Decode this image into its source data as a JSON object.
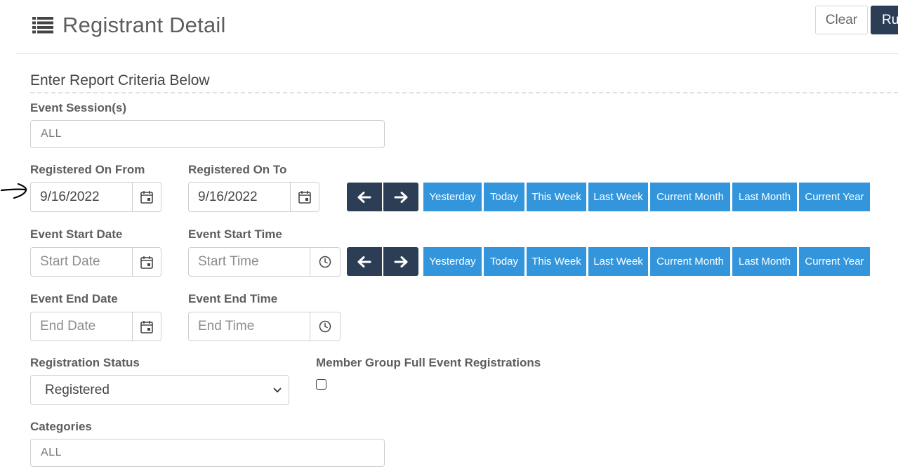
{
  "header": {
    "title": "Registrant Detail",
    "clear_label": "Clear",
    "run_label": "Ru"
  },
  "section_title": "Enter Report Criteria Below",
  "event_sessions": {
    "label": "Event Session(s)",
    "value": "ALL"
  },
  "registered_from": {
    "label": "Registered On From",
    "value": "9/16/2022"
  },
  "registered_to": {
    "label": "Registered On To",
    "value": "9/16/2022"
  },
  "event_start_date": {
    "label": "Event Start Date",
    "placeholder": "Start Date"
  },
  "event_start_time": {
    "label": "Event Start Time",
    "placeholder": "Start Time"
  },
  "event_end_date": {
    "label": "Event End Date",
    "placeholder": "End Date"
  },
  "event_end_time": {
    "label": "Event End Time",
    "placeholder": "End Time"
  },
  "quick_ranges": [
    "Yesterday",
    "Today",
    "This Week",
    "Last Week",
    "Current Month",
    "Last Month",
    "Current Year"
  ],
  "registration_status": {
    "label": "Registration Status",
    "selected": "Registered"
  },
  "member_group": {
    "label": "Member Group Full Event Registrations",
    "checked": false
  },
  "categories": {
    "label": "Categories",
    "value": "ALL"
  },
  "colors": {
    "primary_dark": "#2c3e55",
    "accent_blue": "#3396dc"
  },
  "icons": [
    "list-icon",
    "calendar-icon",
    "clock-icon",
    "arrow-left-icon",
    "arrow-right-icon",
    "chevron-down-icon",
    "hand-drawn-arrow"
  ]
}
